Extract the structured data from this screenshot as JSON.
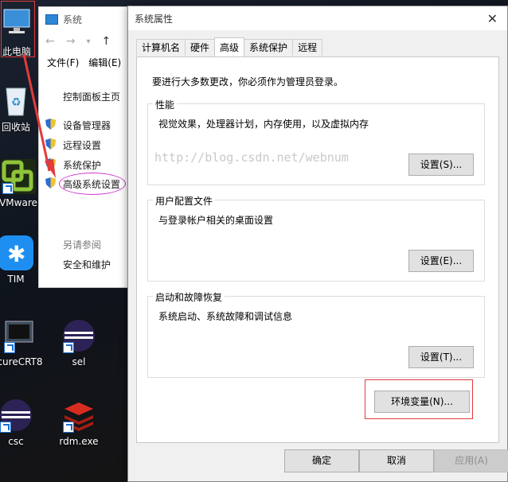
{
  "desktop": {
    "icons": [
      {
        "label": "此电脑",
        "icon": "computer-icon"
      },
      {
        "label": "回收站",
        "icon": "recycle-bin-icon"
      },
      {
        "label": "VMware",
        "icon": "vmware-icon"
      },
      {
        "label": "TIM",
        "icon": "tim-icon"
      },
      {
        "label": "cureCRT8",
        "icon": "securecrt-icon"
      },
      {
        "label": "sel",
        "icon": "eclipse-icon"
      },
      {
        "label": "csc",
        "icon": "eclipse-icon"
      },
      {
        "label": "rdm.exe",
        "icon": "redis-icon"
      }
    ]
  },
  "explorer": {
    "title": "系统",
    "menu": [
      "文件(F)",
      "编辑(E)"
    ],
    "control_panel_home": "控制面板主页",
    "links": [
      "设备管理器",
      "远程设置",
      "系统保护",
      "高级系统设置"
    ],
    "see_also": "另请参阅",
    "security": "安全和维护"
  },
  "dialog": {
    "title": "系统属性",
    "tabs": [
      "计算机名",
      "硬件",
      "高级",
      "系统保护",
      "远程"
    ],
    "active_tab": "高级",
    "admin_notice": "要进行大多数更改，你必须作为管理员登录。",
    "groups": [
      {
        "title": "性能",
        "desc": "视觉效果，处理器计划，内存使用，以及虚拟内存",
        "button": "设置(S)..."
      },
      {
        "title": "用户配置文件",
        "desc": "与登录帐户相关的桌面设置",
        "button": "设置(E)..."
      },
      {
        "title": "启动和故障恢复",
        "desc": "系统启动、系统故障和调试信息",
        "button": "设置(T)..."
      }
    ],
    "watermark": "http://blog.csdn.net/webnum",
    "env_button": "环境变量(N)...",
    "ok": "确定",
    "cancel": "取消",
    "apply": "应用(A)"
  },
  "colors": {
    "accent_annotation": "#e23b3b",
    "ellipse": "#d034d0",
    "dialog_bg": "#f0f0f0"
  }
}
